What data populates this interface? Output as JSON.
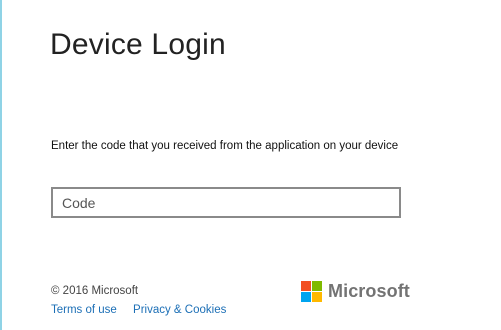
{
  "page": {
    "title": "Device Login",
    "instruction": "Enter the code that you received from the application on your device"
  },
  "code_field": {
    "value": "",
    "placeholder": "Code"
  },
  "footer": {
    "copyright": "© 2016 Microsoft",
    "links": [
      "Terms of use",
      "Privacy & Cookies"
    ]
  },
  "logo": {
    "text": "Microsoft",
    "icon": "microsoft-logo-icon",
    "colors": [
      "#f25022",
      "#7fba00",
      "#00a4ef",
      "#ffb900"
    ]
  },
  "colors": {
    "link": "#1c6fb6",
    "left_rule": "#8fd3e6"
  }
}
